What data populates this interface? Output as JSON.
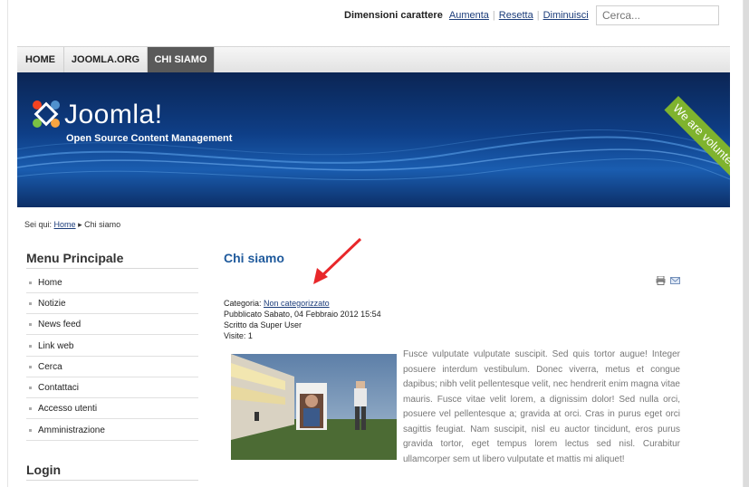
{
  "fontbar": {
    "label": "Dimensioni carattere",
    "increase": "Aumenta",
    "reset": "Resetta",
    "decrease": "Diminuisci"
  },
  "search": {
    "placeholder": "Cerca..."
  },
  "nav": {
    "tabs": [
      "HOME",
      "JOOMLA.ORG",
      "CHI SIAMO"
    ],
    "active": "CHI SIAMO"
  },
  "banner": {
    "logo": "Joomla!",
    "tagline": "Open Source Content Management",
    "ribbon": "We are volunteers!"
  },
  "breadcrumb": {
    "prefix": "Sei qui:",
    "home": "Home",
    "current": "Chi siamo"
  },
  "menu": {
    "title": "Menu Principale",
    "items": [
      "Home",
      "Notizie",
      "News feed",
      "Link web",
      "Cerca",
      "Contattaci",
      "Accesso utenti",
      "Amministrazione"
    ]
  },
  "login": {
    "title": "Login"
  },
  "article": {
    "title": "Chi siamo",
    "category_label": "Categoria:",
    "category": "Non categorizzato",
    "published": "Pubblicato Sabato, 04 Febbraio 2012 15:54",
    "author": "Scritto da Super User",
    "hits": "Visite: 1",
    "body": "Fusce vulputate vulputate suscipit. Sed quis tortor augue! Integer posuere interdum vestibulum. Donec viverra, metus et congue dapibus; nibh velit pellentesque velit, nec hendrerit enim magna vitae mauris. Fusce vitae velit lorem, a dignissim dolor! Sed nulla orci, posuere vel pellentesque a; gravida at orci. Cras in purus eget orci sagittis feugiat. Nam suscipit, nisl eu auctor tincidunt, eros purus gravida tortor, eget tempus lorem lectus sed nisl. Curabitur ullamcorper sem ut libero vulputate et mattis mi aliquet!"
  },
  "colors": {
    "accent_arrow": "#e8272a",
    "link": "#1b3c7a",
    "title": "#1f5a9c",
    "ribbon": "#7fb32e"
  }
}
